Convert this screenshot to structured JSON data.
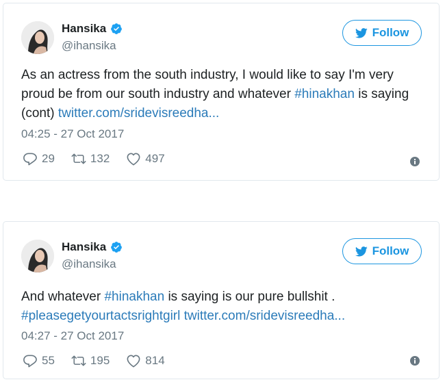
{
  "tweets": [
    {
      "author": {
        "name": "Hansika",
        "handle": "@ihansika"
      },
      "follow_label": "Follow",
      "text_parts": {
        "p1": "As an actress from the south industry, I would like to say I'm very proud be from our south industry and whatever ",
        "link1": "#hinakhan",
        "p2": " is saying (cont) ",
        "link2": "twitter.com/sridevisreedha..."
      },
      "timestamp": "04:25 - 27 Oct 2017",
      "replies": "29",
      "retweets": "132",
      "likes": "497"
    },
    {
      "author": {
        "name": "Hansika",
        "handle": "@ihansika"
      },
      "follow_label": "Follow",
      "text_parts": {
        "p1": "And whatever ",
        "link1": "#hinakhan",
        "p2": " is saying is our pure bullshit .",
        "link2": "#pleasegetyourtactsrightgirl",
        "p3": " ",
        "link3": "twitter.com/sridevisreedha..."
      },
      "timestamp": "04:27 - 27 Oct 2017",
      "replies": "55",
      "retweets": "195",
      "likes": "814"
    }
  ],
  "colors": {
    "accent": "#1b95e0",
    "link": "#2b7bb9",
    "muted": "#697882",
    "border": "#e1e8ed"
  },
  "icons": [
    "verified-badge-icon",
    "twitter-bird-icon",
    "reply-icon",
    "retweet-icon",
    "like-icon",
    "info-icon"
  ]
}
